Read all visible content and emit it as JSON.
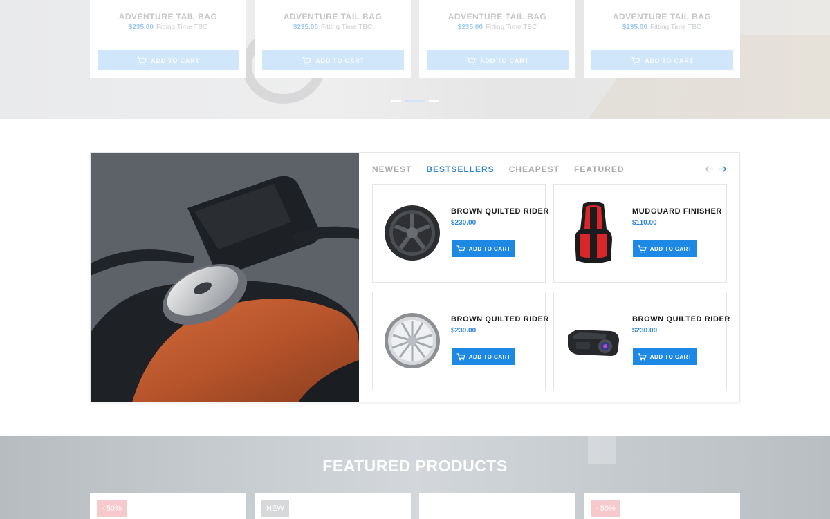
{
  "top_carousel": {
    "cards": [
      {
        "title": "ADVENTURE TAIL BAG",
        "price": "$235.00",
        "note": "Fitting Time TBC",
        "button": "ADD TO CART"
      },
      {
        "title": "ADVENTURE TAIL BAG",
        "price": "$235.00",
        "note": "Fitting Time TBC",
        "button": "ADD TO CART"
      },
      {
        "title": "ADVENTURE TAIL BAG",
        "price": "$235.00",
        "note": "Fitting Time TBC",
        "button": "ADD TO CART"
      },
      {
        "title": "ADVENTURE TAIL BAG",
        "price": "$235.00",
        "note": "Fitting Time TBC",
        "button": "ADD TO CART"
      }
    ],
    "active_dot": 1,
    "dot_count": 3
  },
  "promo": {
    "tabs": [
      "NEWEST",
      "BESTSELLERS",
      "CHEAPEST",
      "FEATURED"
    ],
    "active_tab": "BESTSELLERS",
    "products": [
      {
        "name": "BROWN QUILTED RIDER",
        "price": "$230.00",
        "button": "ADD TO CART",
        "image": "dark-wheel"
      },
      {
        "name": "MUDGUARD FINISHER",
        "price": "$110.00",
        "button": "ADD TO CART",
        "image": "red-seat"
      },
      {
        "name": "BROWN QUILTED RIDER",
        "price": "$230.00",
        "button": "ADD TO CART",
        "image": "silver-wheel"
      },
      {
        "name": "BROWN QUILTED RIDER",
        "price": "$230.00",
        "button": "ADD TO CART",
        "image": "dash-camera"
      }
    ]
  },
  "featured": {
    "title": "FEATURED PRODUCTS",
    "badges": [
      "- 50%",
      "NEW",
      "",
      "- 50%"
    ]
  },
  "colors": {
    "accent": "#1e88e5",
    "accent_text": "#2f86d6",
    "tab_inactive": "#a9abad"
  }
}
